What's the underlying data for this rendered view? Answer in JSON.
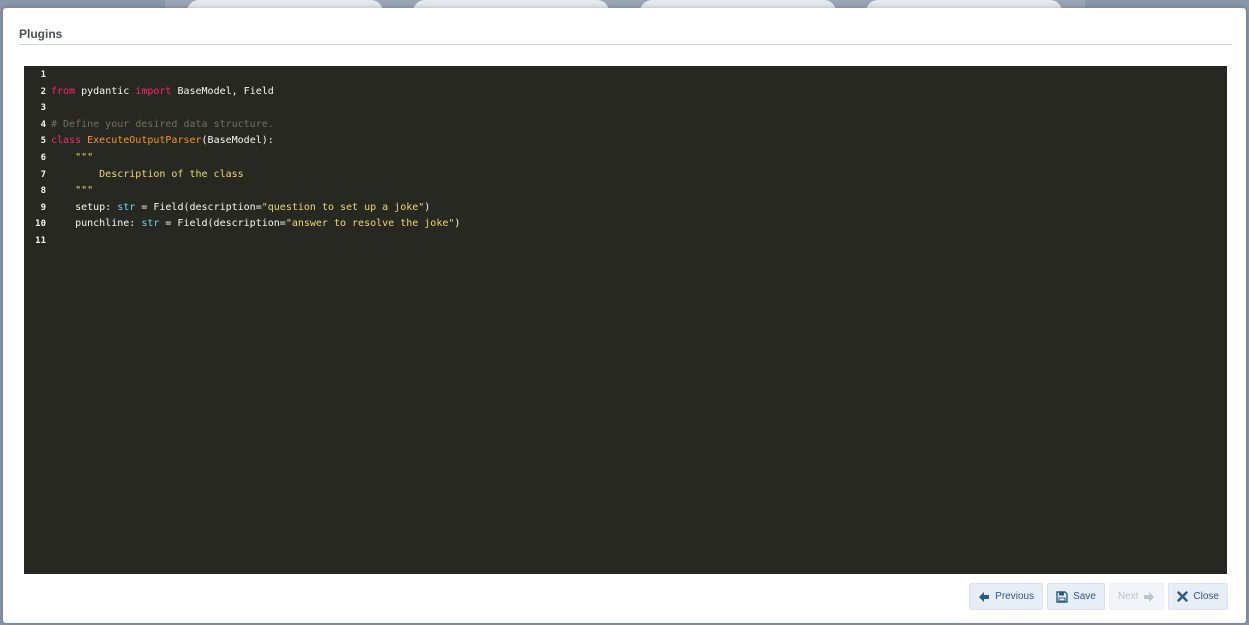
{
  "modal": {
    "title": "Plugins"
  },
  "editor": {
    "lines": [
      {
        "num": "1",
        "tokens": []
      },
      {
        "num": "2",
        "tokens": [
          {
            "t": "kw",
            "v": "from"
          },
          {
            "t": "plain",
            "v": " pydantic "
          },
          {
            "t": "kw",
            "v": "import"
          },
          {
            "t": "plain",
            "v": " BaseModel, Field"
          }
        ]
      },
      {
        "num": "3",
        "tokens": []
      },
      {
        "num": "4",
        "tokens": [
          {
            "t": "comment",
            "v": "# Define your desired data structure."
          }
        ]
      },
      {
        "num": "5",
        "tokens": [
          {
            "t": "kw",
            "v": "class"
          },
          {
            "t": "plain",
            "v": " "
          },
          {
            "t": "class",
            "v": "ExecuteOutputParser"
          },
          {
            "t": "plain",
            "v": "(BaseModel):"
          }
        ]
      },
      {
        "num": "6",
        "tokens": [
          {
            "t": "plain",
            "v": "    "
          },
          {
            "t": "str",
            "v": "\"\"\""
          }
        ]
      },
      {
        "num": "7",
        "tokens": [
          {
            "t": "str",
            "v": "        Description of the class"
          }
        ]
      },
      {
        "num": "8",
        "tokens": [
          {
            "t": "plain",
            "v": "    "
          },
          {
            "t": "str",
            "v": "\"\"\""
          }
        ]
      },
      {
        "num": "9",
        "tokens": [
          {
            "t": "plain",
            "v": "    setup: "
          },
          {
            "t": "type",
            "v": "str"
          },
          {
            "t": "plain",
            "v": " = Field(description="
          },
          {
            "t": "str",
            "v": "\"question to set up a joke\""
          },
          {
            "t": "plain",
            "v": ")"
          }
        ]
      },
      {
        "num": "10",
        "tokens": [
          {
            "t": "plain",
            "v": "    punchline: "
          },
          {
            "t": "type",
            "v": "str"
          },
          {
            "t": "plain",
            "v": " = Field(description="
          },
          {
            "t": "str",
            "v": "\"answer to resolve the joke\""
          },
          {
            "t": "plain",
            "v": ")"
          }
        ]
      },
      {
        "num": "11",
        "tokens": []
      }
    ]
  },
  "footer": {
    "previous_label": "Previous",
    "save_label": "Save",
    "next_label": "Next",
    "close_label": "Close"
  },
  "colors": {
    "editor_bg": "#272822",
    "keyword": "#f92672",
    "string": "#e6db74",
    "comment": "#75715e",
    "class_name": "#fd971f",
    "builtin_type": "#66d9ef",
    "button_text": "#2a5a8c"
  },
  "icons": {
    "previous": "arrow-left-icon",
    "save": "floppy-disk-icon",
    "next": "arrow-right-icon",
    "close": "close-icon"
  }
}
